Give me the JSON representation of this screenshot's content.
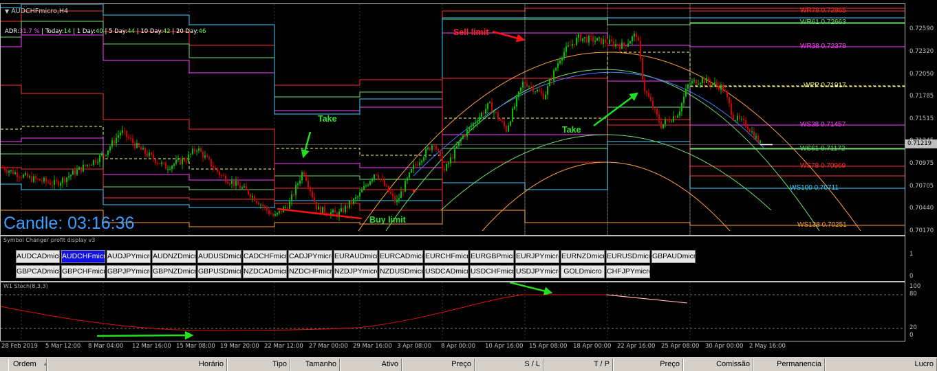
{
  "window": {
    "title": "AUDCHFmicro,H4",
    "adr": {
      "label": "ADR:",
      "value": "31.7 %",
      "today_label": "Today:",
      "today": "14",
      "day1_label": "1 Day:",
      "day1": "40",
      "day5_label": "5 Day:",
      "day5": "44",
      "day10_label": "10 Day:",
      "day10": "42",
      "day20_label": "20 Day:",
      "day20": "46"
    },
    "candle_timer": "Candle:  03:16:36"
  },
  "price_axis": {
    "ticks": [
      "0.72590",
      "0.72320",
      "0.72050",
      "0.71785",
      "0.71515",
      "0.71245",
      "0.70975",
      "0.70705",
      "0.70440",
      "0.70170"
    ],
    "current_price": "0.71219"
  },
  "levels": [
    {
      "name": "WR78",
      "value": "0.72865",
      "color": "#ff3030"
    },
    {
      "name": "WR61",
      "value": "0.72663",
      "color": "#70e070"
    },
    {
      "name": "WR38",
      "value": "0.72378",
      "color": "#ff40ff"
    },
    {
      "name": "WPP",
      "value": "0.71917",
      "color": "#ffff80"
    },
    {
      "name": "WS38",
      "value": "0.71457",
      "color": "#ff40ff"
    },
    {
      "name": "WS61",
      "value": "0.71172",
      "color": "#70e070"
    },
    {
      "name": "WS78",
      "value": "0.70969",
      "color": "#ff3030"
    },
    {
      "name": "WS100",
      "value": "0.70711",
      "color": "#40d0ff"
    },
    {
      "name": "WS138",
      "value": "0.70251",
      "color": "#ffa040"
    }
  ],
  "annotations": {
    "sell_limit": "Sell limit",
    "buy_limit": "Buy limit",
    "take1": "Take",
    "take2": "Take"
  },
  "symbol_panel": {
    "title": "Symbol Changer profit display v3",
    "axis_top": "1",
    "axis_bottom": "0",
    "row1": [
      "AUDCADmicro",
      "AUDCHFmicro",
      "AUDJPYmicro",
      "AUDNZDmicro",
      "AUDUSDmicro",
      "CADCHFmicro",
      "CADJPYmicro",
      "EURAUDmicro",
      "EURCADmicro",
      "EURCHFmicro",
      "EURGBPmicro",
      "EURJPYmicro",
      "EURNZDmicro",
      "EURUSDmicro",
      "GBPAUDmicro"
    ],
    "row2": [
      "GBPCADmicro",
      "GBPCHFmicro",
      "GBPJPYmicro",
      "GBPNZDmicro",
      "GBPUSDmicro",
      "NZDCADmicro",
      "NZDCHFmicro",
      "NZDJPYmicro",
      "NZDUSDmicro",
      "USDCADmicro",
      "USDCHFmicro",
      "USDJPYmicro",
      "GOLDmicro",
      "CHFJPYmicro"
    ],
    "active": "AUDCHFmicro"
  },
  "stoch_panel": {
    "title": "W1 Stoch(8,3,3)",
    "ticks": [
      "100",
      "80",
      "20",
      "0"
    ]
  },
  "time_axis": [
    "28 Feb 2019",
    "5 Mar 12:00",
    "8 Mar 04:00",
    "12 Mar 16:00",
    "15 Mar 08:00",
    "19 Mar 20:00",
    "22 Mar 12:00",
    "27 Mar 00:00",
    "29 Mar 16:00",
    "3 Apr 08:00",
    "8 Apr 00:00",
    "10 Apr 16:00",
    "15 Apr 08:00",
    "18 Apr 00:00",
    "22 Apr 16:00",
    "25 Apr 08:00",
    "30 Apr 00:00",
    "2 May 16:00"
  ],
  "terminal_columns": [
    "Ordem",
    "Horário",
    "Tipo",
    "Tamanho",
    "Ativo",
    "Preço",
    "S / L",
    "T / P",
    "Preço",
    "Comissão",
    "Permanencia",
    "Lucro"
  ],
  "colors": {
    "bull": "#00c000",
    "bear": "#d00000",
    "arrow_red": "#ff1010",
    "arrow_green": "#20e020",
    "timer": "#3aa0ff"
  }
}
